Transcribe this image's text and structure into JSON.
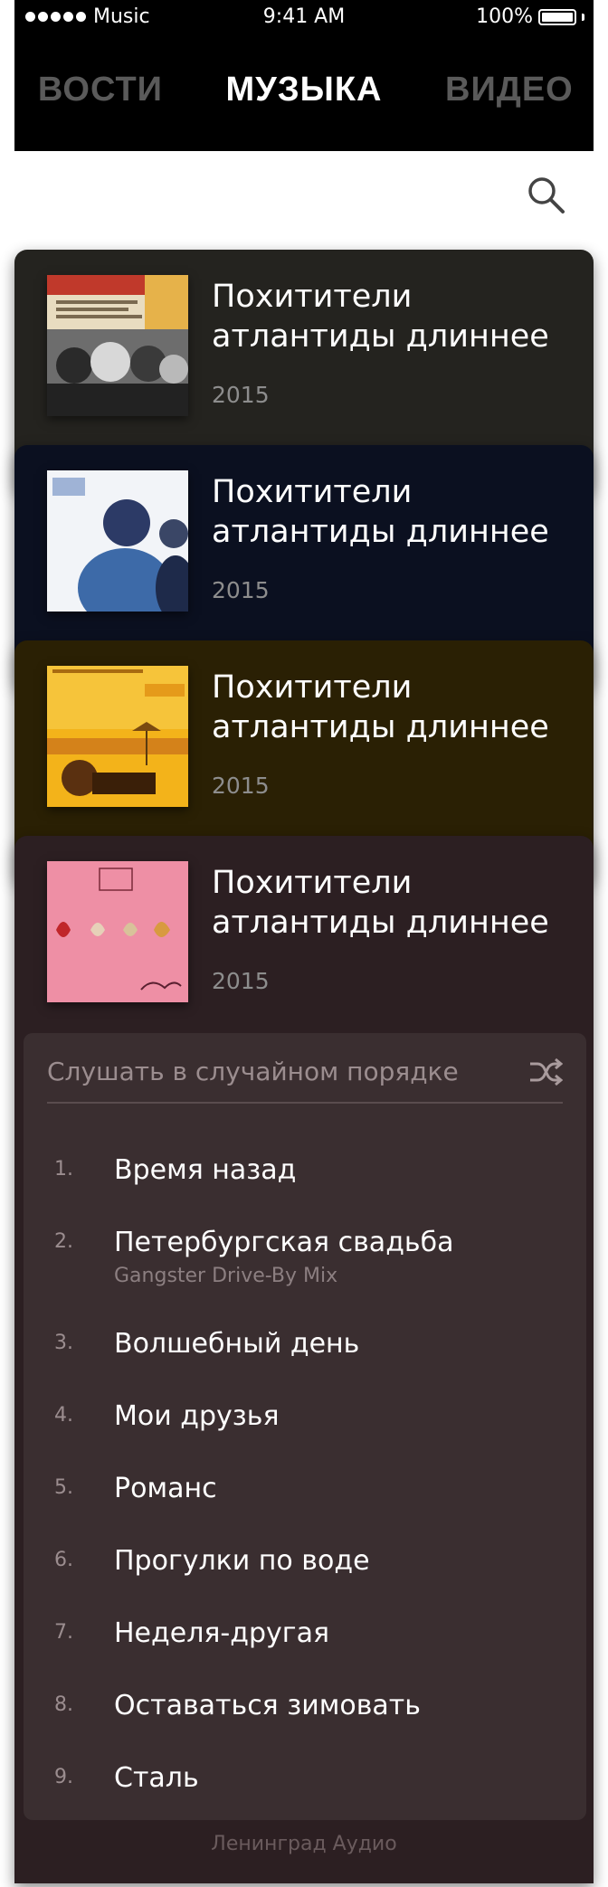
{
  "status_bar": {
    "carrier": "Music",
    "time": "9:41 AM",
    "battery": "100%"
  },
  "tabs": [
    {
      "label": "ВОСТИ"
    },
    {
      "label": "МУЗЫКА"
    },
    {
      "label": "ВИДЕО"
    }
  ],
  "search": {
    "icon": "search-icon"
  },
  "albums": [
    {
      "title": "Похитители атлантиды длиннее",
      "year": "2015",
      "color": "#24231f"
    },
    {
      "title": "Похитители атлантиды длиннее",
      "year": "2015",
      "color": "#0b1020"
    },
    {
      "title": "Похитители атлантиды длиннее",
      "year": "2015",
      "color": "#2a2004"
    },
    {
      "title": "Похитители атлантиды длиннее",
      "year": "2015",
      "color": "#2c1f22"
    }
  ],
  "tracklist": {
    "shuffle_label": "Слушать в случайном порядке",
    "shuffle_icon": "shuffle-icon",
    "tracks": [
      {
        "num": "1.",
        "title": "Время назад"
      },
      {
        "num": "2.",
        "title": "Петербургская свадьба",
        "subtitle": "Gangster Drive-By Mix"
      },
      {
        "num": "3.",
        "title": "Волшебный день"
      },
      {
        "num": "4.",
        "title": "Мои друзья"
      },
      {
        "num": "5.",
        "title": "Романс"
      },
      {
        "num": "6.",
        "title": "Прогулки по воде"
      },
      {
        "num": "7.",
        "title": "Неделя-другая"
      },
      {
        "num": "8.",
        "title": "Оставаться зимовать"
      },
      {
        "num": "9.",
        "title": "Сталь"
      }
    ]
  },
  "footer": {
    "label": "Ленинград Аудио"
  }
}
